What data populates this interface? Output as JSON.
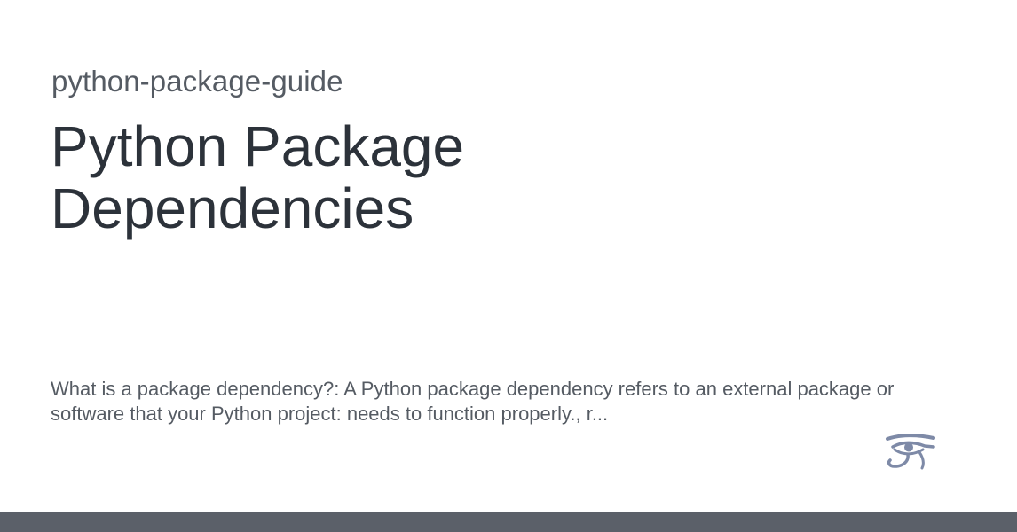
{
  "card": {
    "repo_name": "python-package-guide",
    "title": "Python Package Dependencies",
    "description": "What is a package dependency?: A Python package dependency refers to an external package or software that your Python project: needs to function properly., r...",
    "logo_icon": "eye-of-horus-icon"
  },
  "colors": {
    "repo_text": "#555b63",
    "title_text": "#2c323a",
    "logo": "#7e8aa7",
    "footer_bar": "#5b6069"
  }
}
